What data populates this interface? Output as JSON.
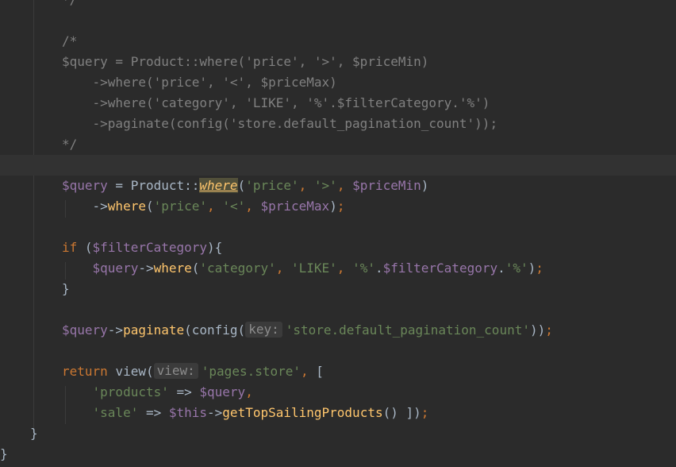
{
  "editor": {
    "theme": "darcula",
    "colors": {
      "background": "#2b2b2b",
      "current_line": "#323232",
      "comment": "#808080",
      "variable": "#9876aa",
      "string": "#6a8759",
      "keyword": "#cc7832",
      "function": "#ffc66d",
      "plain": "#a9b7c6"
    },
    "lines": [
      {
        "tokens": [
          {
            "t": "comment",
            "v": "*/"
          }
        ]
      },
      {
        "tokens": []
      },
      {
        "tokens": [
          {
            "t": "comment",
            "v": "/*"
          }
        ]
      },
      {
        "tokens": [
          {
            "t": "comment",
            "v": "$query = Product::where('price', '>', $priceMin)"
          }
        ]
      },
      {
        "tokens": [
          {
            "t": "comment",
            "v": "    ->where('price', '<', $priceMax)"
          }
        ]
      },
      {
        "tokens": [
          {
            "t": "comment",
            "v": "    ->where('category', 'LIKE', '%'.$filterCategory.'%')"
          }
        ]
      },
      {
        "tokens": [
          {
            "t": "comment",
            "v": "    ->paginate(config('store.default_pagination_count'));"
          }
        ]
      },
      {
        "tokens": [
          {
            "t": "comment",
            "v": "*/"
          }
        ]
      },
      {
        "tokens": [],
        "current": true
      },
      {
        "tokens": [
          {
            "t": "var",
            "v": "$query"
          },
          {
            "t": "plain",
            "v": " = Product::"
          },
          {
            "t": "hl-where",
            "v": "where"
          },
          {
            "t": "plain",
            "v": "("
          },
          {
            "t": "str",
            "v": "'price'"
          },
          {
            "t": "semi",
            "v": ", "
          },
          {
            "t": "str",
            "v": "'>'"
          },
          {
            "t": "semi",
            "v": ", "
          },
          {
            "t": "var",
            "v": "$priceMin"
          },
          {
            "t": "plain",
            "v": ")"
          }
        ]
      },
      {
        "tokens": [
          {
            "t": "plain",
            "v": "    ->"
          },
          {
            "t": "fn",
            "v": "where"
          },
          {
            "t": "plain",
            "v": "("
          },
          {
            "t": "str",
            "v": "'price'"
          },
          {
            "t": "semi",
            "v": ", "
          },
          {
            "t": "str",
            "v": "'<'"
          },
          {
            "t": "semi",
            "v": ", "
          },
          {
            "t": "var",
            "v": "$priceMax"
          },
          {
            "t": "plain",
            "v": ")"
          },
          {
            "t": "semi",
            "v": ";"
          }
        ]
      },
      {
        "tokens": []
      },
      {
        "tokens": [
          {
            "t": "kw",
            "v": "if "
          },
          {
            "t": "plain",
            "v": "("
          },
          {
            "t": "var",
            "v": "$filterCategory"
          },
          {
            "t": "plain",
            "v": "){"
          }
        ]
      },
      {
        "tokens": [
          {
            "t": "plain",
            "v": "    "
          },
          {
            "t": "var",
            "v": "$query"
          },
          {
            "t": "plain",
            "v": "->"
          },
          {
            "t": "fn",
            "v": "where"
          },
          {
            "t": "plain",
            "v": "("
          },
          {
            "t": "str",
            "v": "'category'"
          },
          {
            "t": "semi",
            "v": ", "
          },
          {
            "t": "str",
            "v": "'LIKE'"
          },
          {
            "t": "semi",
            "v": ", "
          },
          {
            "t": "str",
            "v": "'%'"
          },
          {
            "t": "plain",
            "v": "."
          },
          {
            "t": "var",
            "v": "$filterCategory"
          },
          {
            "t": "plain",
            "v": "."
          },
          {
            "t": "str",
            "v": "'%'"
          },
          {
            "t": "plain",
            "v": ")"
          },
          {
            "t": "semi",
            "v": ";"
          }
        ]
      },
      {
        "tokens": [
          {
            "t": "plain",
            "v": "}"
          }
        ]
      },
      {
        "tokens": []
      },
      {
        "tokens": [
          {
            "t": "var",
            "v": "$query"
          },
          {
            "t": "plain",
            "v": "->"
          },
          {
            "t": "fn",
            "v": "paginate"
          },
          {
            "t": "plain",
            "v": "(config("
          },
          {
            "t": "hint",
            "v": "key:"
          },
          {
            "t": "str",
            "v": "'store.default_pagination_count'"
          },
          {
            "t": "plain",
            "v": "))"
          },
          {
            "t": "semi",
            "v": ";"
          }
        ]
      },
      {
        "tokens": []
      },
      {
        "tokens": [
          {
            "t": "kw",
            "v": "return "
          },
          {
            "t": "plain",
            "v": "view("
          },
          {
            "t": "hint",
            "v": "view:"
          },
          {
            "t": "str",
            "v": "'pages.store'"
          },
          {
            "t": "semi",
            "v": ", "
          },
          {
            "t": "plain",
            "v": "["
          }
        ]
      },
      {
        "tokens": [
          {
            "t": "plain",
            "v": "    "
          },
          {
            "t": "str",
            "v": "'products'"
          },
          {
            "t": "plain",
            "v": " => "
          },
          {
            "t": "var",
            "v": "$query"
          },
          {
            "t": "semi",
            "v": ","
          }
        ]
      },
      {
        "tokens": [
          {
            "t": "plain",
            "v": "    "
          },
          {
            "t": "str",
            "v": "'sale'"
          },
          {
            "t": "plain",
            "v": " => "
          },
          {
            "t": "var",
            "v": "$this"
          },
          {
            "t": "plain",
            "v": "->"
          },
          {
            "t": "fn",
            "v": "getTopSailingProducts"
          },
          {
            "t": "plain",
            "v": "() ])"
          },
          {
            "t": "semi",
            "v": ";"
          }
        ]
      },
      {
        "tokens": [
          {
            "t": "plain",
            "v": "}"
          }
        ]
      },
      {
        "tokens": [
          {
            "t": "plain",
            "v": "}"
          }
        ]
      }
    ]
  }
}
